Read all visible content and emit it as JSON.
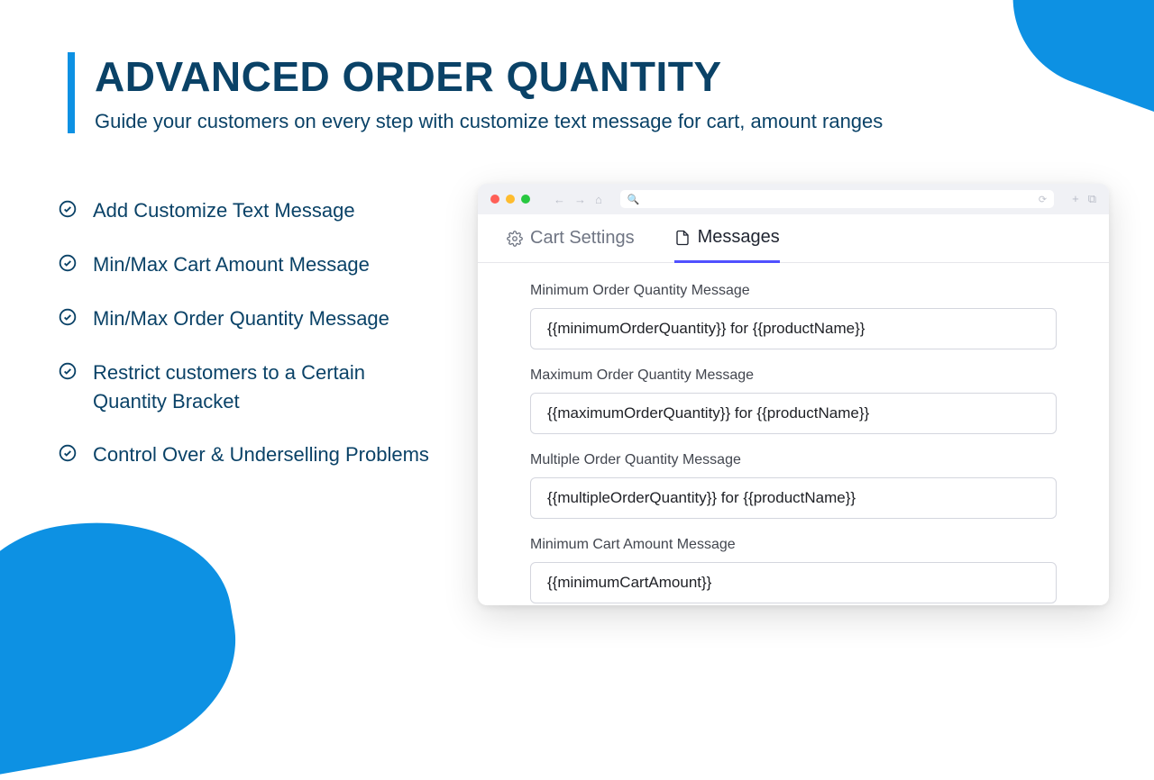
{
  "header": {
    "title": "ADVANCED ORDER QUANTITY",
    "subtitle": "Guide your customers on every step with customize text message for cart, amount ranges"
  },
  "features": [
    "Add Customize Text Message",
    "Min/Max Cart Amount Message",
    "Min/Max Order Quantity Message",
    "Restrict customers to a Certain Quantity Bracket",
    "Control  Over & Underselling Problems"
  ],
  "tabs": {
    "cart": "Cart Settings",
    "messages": "Messages"
  },
  "fields": {
    "minQty": {
      "label": "Minimum Order Quantity Message",
      "value": "{{minimumOrderQuantity}} for {{productName}}"
    },
    "maxQty": {
      "label": "Maximum Order Quantity Message",
      "value": "{{maximumOrderQuantity}} for {{productName}}"
    },
    "multQty": {
      "label": "Multiple Order Quantity Message",
      "value": "{{multipleOrderQuantity}} for {{productName}}"
    },
    "minCart": {
      "label": "Minimum Cart Amount Message",
      "value": "{{minimumCartAmount}}"
    }
  },
  "colors": {
    "brand": "#0d91e3",
    "heading": "#0a4267",
    "tabActive": "#5050ff"
  }
}
